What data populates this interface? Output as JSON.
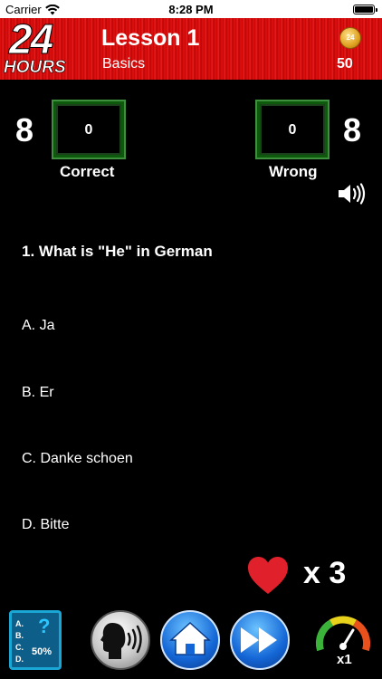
{
  "status_bar": {
    "carrier": "Carrier",
    "time": "8:28 PM"
  },
  "header": {
    "logo_number": "24",
    "logo_word": "HOURS",
    "title": "Lesson 1",
    "subtitle": "Basics",
    "coin_label": "24",
    "coins": "50"
  },
  "score": {
    "correct_total": "8",
    "correct_value": "0",
    "correct_label": "Correct",
    "wrong_total": "8",
    "wrong_value": "0",
    "wrong_label": "Wrong"
  },
  "question": "1. What is \"He\" in German",
  "answers": [
    "A. Ja",
    "B. Er",
    "C. Danke schoen",
    "D. Bitte"
  ],
  "lives": "x 3",
  "toolbar": {
    "hint_letters": [
      "A.",
      "B.",
      "C.",
      "D."
    ],
    "hint_question": "?",
    "hint_percent": "50%",
    "speed": "x1"
  },
  "colors": {
    "header_red": "#e31010",
    "box_green": "#3e8f3e",
    "heart_red": "#e0202a",
    "hint_blue": "#1aa7d6"
  },
  "icons": [
    "wifi-icon",
    "battery-icon",
    "coin-icon",
    "speaker-icon",
    "heart-icon",
    "hint-icon",
    "speak-icon",
    "home-icon",
    "fast-forward-icon",
    "speed-gauge-icon"
  ]
}
